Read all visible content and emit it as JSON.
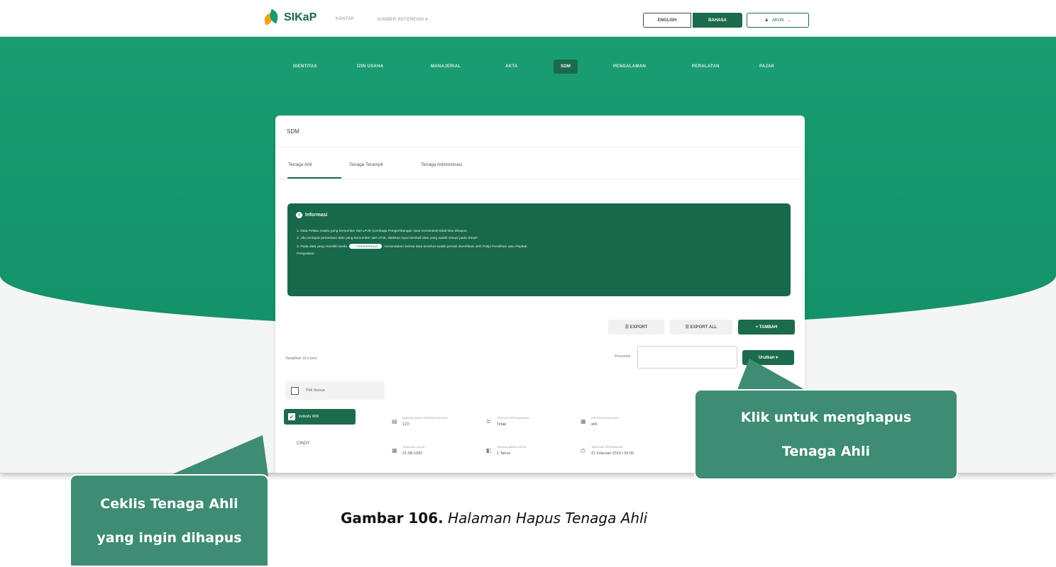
{
  "header": {
    "brand": "SIKaP",
    "nav_links": [
      "KONTAK",
      "SUMBER REFERENSI ▾"
    ],
    "lang_en": "ENGLISH",
    "lang_id": "BAHASA",
    "account": "AKUN"
  },
  "main_nav": [
    "IDENTITAS",
    "IZIN USAHA",
    "MANAJERIAL",
    "AKTA",
    "SDM",
    "PENGALAMAN",
    "PERALATAN",
    "PAJAK"
  ],
  "card": {
    "title": "SDM",
    "tabs": [
      "Tenaga Ahli",
      "Tenaga Terampil",
      "Tenaga Administrasi"
    ]
  },
  "info": {
    "title": "Informasi",
    "line1": "1. Data Pelaku Usaha yang bersumber dari LPJK (Lembaga Pengembangan Jasa Konstruksi) tidak bisa dihapus.",
    "line2": "2. Jika terdapat perbedaan data yang bersumber dari LPJK, silahkan input kembali data yang sudah sesuai pada SIKaP.",
    "line3_a": "3. Pada data yang memiliki tanda",
    "badge": "✓ TERVERIFIKASI",
    "line3_b": "menandakan bahwa data tersebut sudah pernah diverifikasi oleh Pokja Pemilihan atau Pejabat",
    "line4": "Pengadaan."
  },
  "toolbar": {
    "export": "☰ EXPORT",
    "export_all": "☰ EXPORT ALL",
    "tambah": "+ TAMBAH",
    "show_label": "Tampilkan  10 ▾  entri",
    "search_label": "Pencarian",
    "sort": "Urutkan ▾"
  },
  "list": {
    "select_all": "Pilih Semua",
    "row_check_label": "Individu WNI",
    "row_name": "CINDY",
    "fields": [
      {
        "icon": "id-card-icon",
        "glyph": "▤",
        "label": "NOMOR INDUK KEPENDUDUKAN",
        "value": "123"
      },
      {
        "icon": "status-icon",
        "glyph": "≣",
        "label": "STATUS KEPEGAWAIAN",
        "value": "Tetap"
      },
      {
        "icon": "profession-icon",
        "glyph": "▦",
        "label": "PROFESI/KEAHLIAN",
        "value": "ahli"
      },
      {
        "icon": "calendar-icon",
        "glyph": "▦",
        "label": "TANGGAL LAHIR",
        "value": "21-08-1992"
      },
      {
        "icon": "experience-icon",
        "glyph": "◧",
        "label": "PENGALAMAN KERJA",
        "value": "1 Tahun"
      },
      {
        "icon": "clock-icon",
        "glyph": "◷",
        "label": "TANGGAL PERUBAHAN",
        "value": "21 Februari 2019 | 09:06"
      }
    ]
  },
  "callouts": {
    "right_line1": "Klik untuk menghapus",
    "right_line2": "Tenaga Ahli",
    "left_line1": "Ceklis Tenaga Ahli",
    "left_line2": "yang ingin dihapus"
  },
  "caption": {
    "label": "Gambar 106.",
    "title": "Halaman Hapus Tenaga Ahli"
  },
  "colors": {
    "primary": "#1c6b4c",
    "hero": "#1a9d72",
    "callout": "#3e8c73"
  }
}
